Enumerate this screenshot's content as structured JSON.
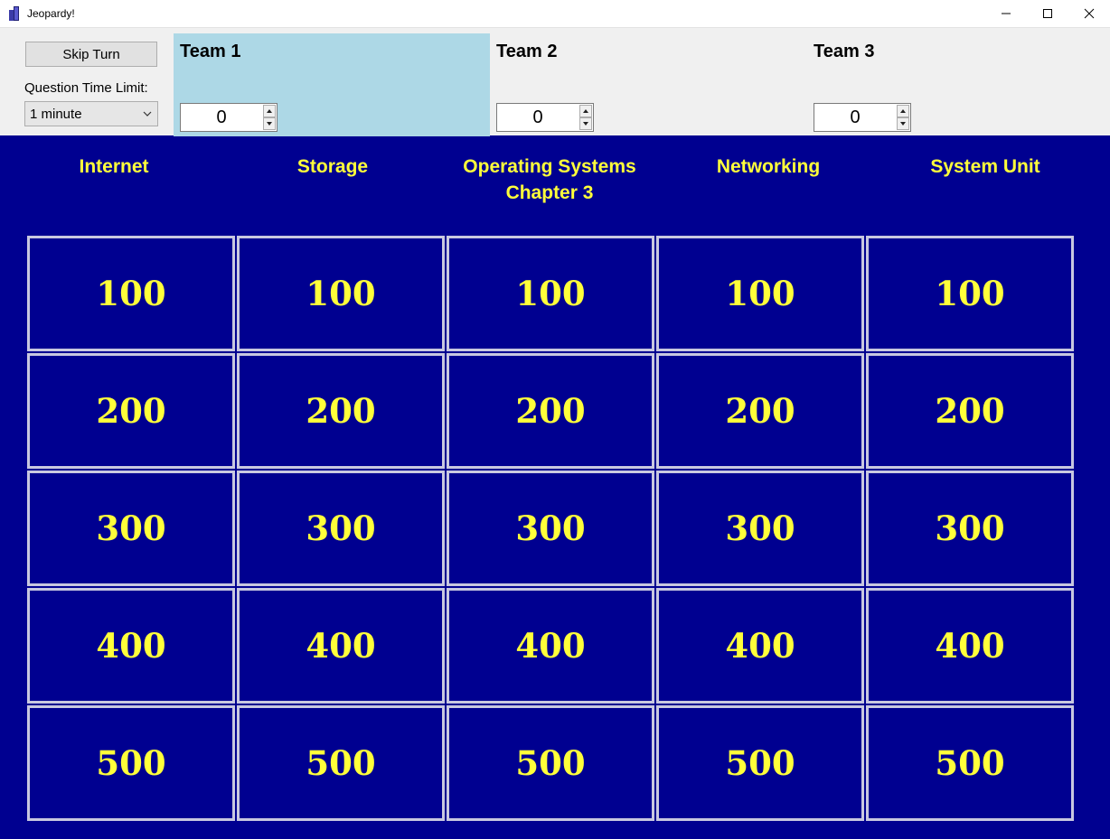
{
  "window": {
    "title": "Jeopardy!"
  },
  "toolbar": {
    "skip_turn_label": "Skip Turn",
    "time_limit_label": "Question Time Limit:",
    "time_limit_value": "1 minute"
  },
  "teams": [
    {
      "name": "Team 1",
      "score": "0",
      "active": true
    },
    {
      "name": "Team 2",
      "score": "0",
      "active": false
    },
    {
      "name": "Team 3",
      "score": "0",
      "active": false
    }
  ],
  "categories": [
    {
      "line1": "Internet",
      "line2": ""
    },
    {
      "line1": "Storage",
      "line2": ""
    },
    {
      "line1": "Operating Systems",
      "line2": "Chapter 3"
    },
    {
      "line1": "Networking",
      "line2": ""
    },
    {
      "line1": "System Unit",
      "line2": ""
    }
  ],
  "point_values": [
    "100",
    "200",
    "300",
    "400",
    "500"
  ],
  "colors": {
    "board_background": "#000090",
    "board_text": "#ffff3a",
    "active_team": "#add8e6",
    "cell_border": "#c8c8e0"
  }
}
